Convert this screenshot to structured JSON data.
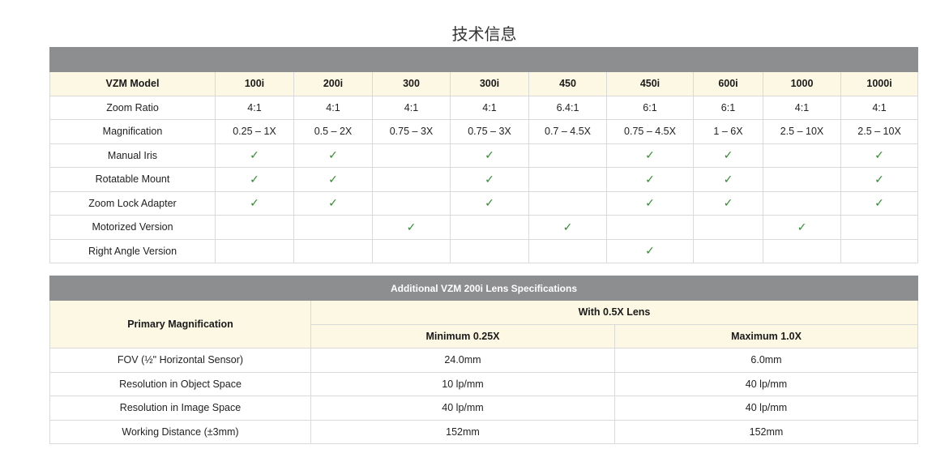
{
  "page_title": "技术信息",
  "table1": {
    "header_label": "VZM Model",
    "models": [
      "100i",
      "200i",
      "300",
      "300i",
      "450",
      "450i",
      "600i",
      "1000",
      "1000i"
    ],
    "check_symbol": "✓",
    "rows": [
      {
        "label": "Zoom Ratio",
        "cells": [
          "4:1",
          "4:1",
          "4:1",
          "4:1",
          "6.4:1",
          "6:1",
          "6:1",
          "4:1",
          "4:1"
        ]
      },
      {
        "label": "Magnification",
        "cells": [
          "0.25 – 1X",
          "0.5 – 2X",
          "0.75 – 3X",
          "0.75 – 3X",
          "0.7 – 4.5X",
          "0.75 – 4.5X",
          "1 – 6X",
          "2.5 – 10X",
          "2.5 – 10X"
        ]
      },
      {
        "label": "Manual Iris",
        "checks": [
          true,
          true,
          false,
          true,
          false,
          true,
          true,
          false,
          true
        ]
      },
      {
        "label": "Rotatable Mount",
        "checks": [
          true,
          true,
          false,
          true,
          false,
          true,
          true,
          false,
          true
        ]
      },
      {
        "label": "Zoom Lock Adapter",
        "checks": [
          true,
          true,
          false,
          true,
          false,
          true,
          true,
          false,
          true
        ]
      },
      {
        "label": "Motorized Version",
        "checks": [
          false,
          false,
          true,
          false,
          true,
          false,
          false,
          true,
          false
        ]
      },
      {
        "label": "Right Angle Version",
        "checks": [
          false,
          false,
          false,
          false,
          false,
          true,
          false,
          false,
          false
        ]
      }
    ]
  },
  "table2": {
    "title": "Additional VZM 200i Lens Specifications",
    "primary_label": "Primary Magnification",
    "lens_label": "With 0.5X Lens",
    "min_label": "Minimum 0.25X",
    "max_label": "Maximum 1.0X",
    "rows": [
      {
        "label": "FOV (½\" Horizontal Sensor)",
        "min": "24.0mm",
        "max": "6.0mm"
      },
      {
        "label": "Resolution in Object Space",
        "min": "10 lp/mm",
        "max": "40 lp/mm"
      },
      {
        "label": "Resolution in Image Space",
        "min": "40 lp/mm",
        "max": "40 lp/mm"
      },
      {
        "label": "Working Distance (±3mm)",
        "min": "152mm",
        "max": "152mm"
      }
    ]
  }
}
